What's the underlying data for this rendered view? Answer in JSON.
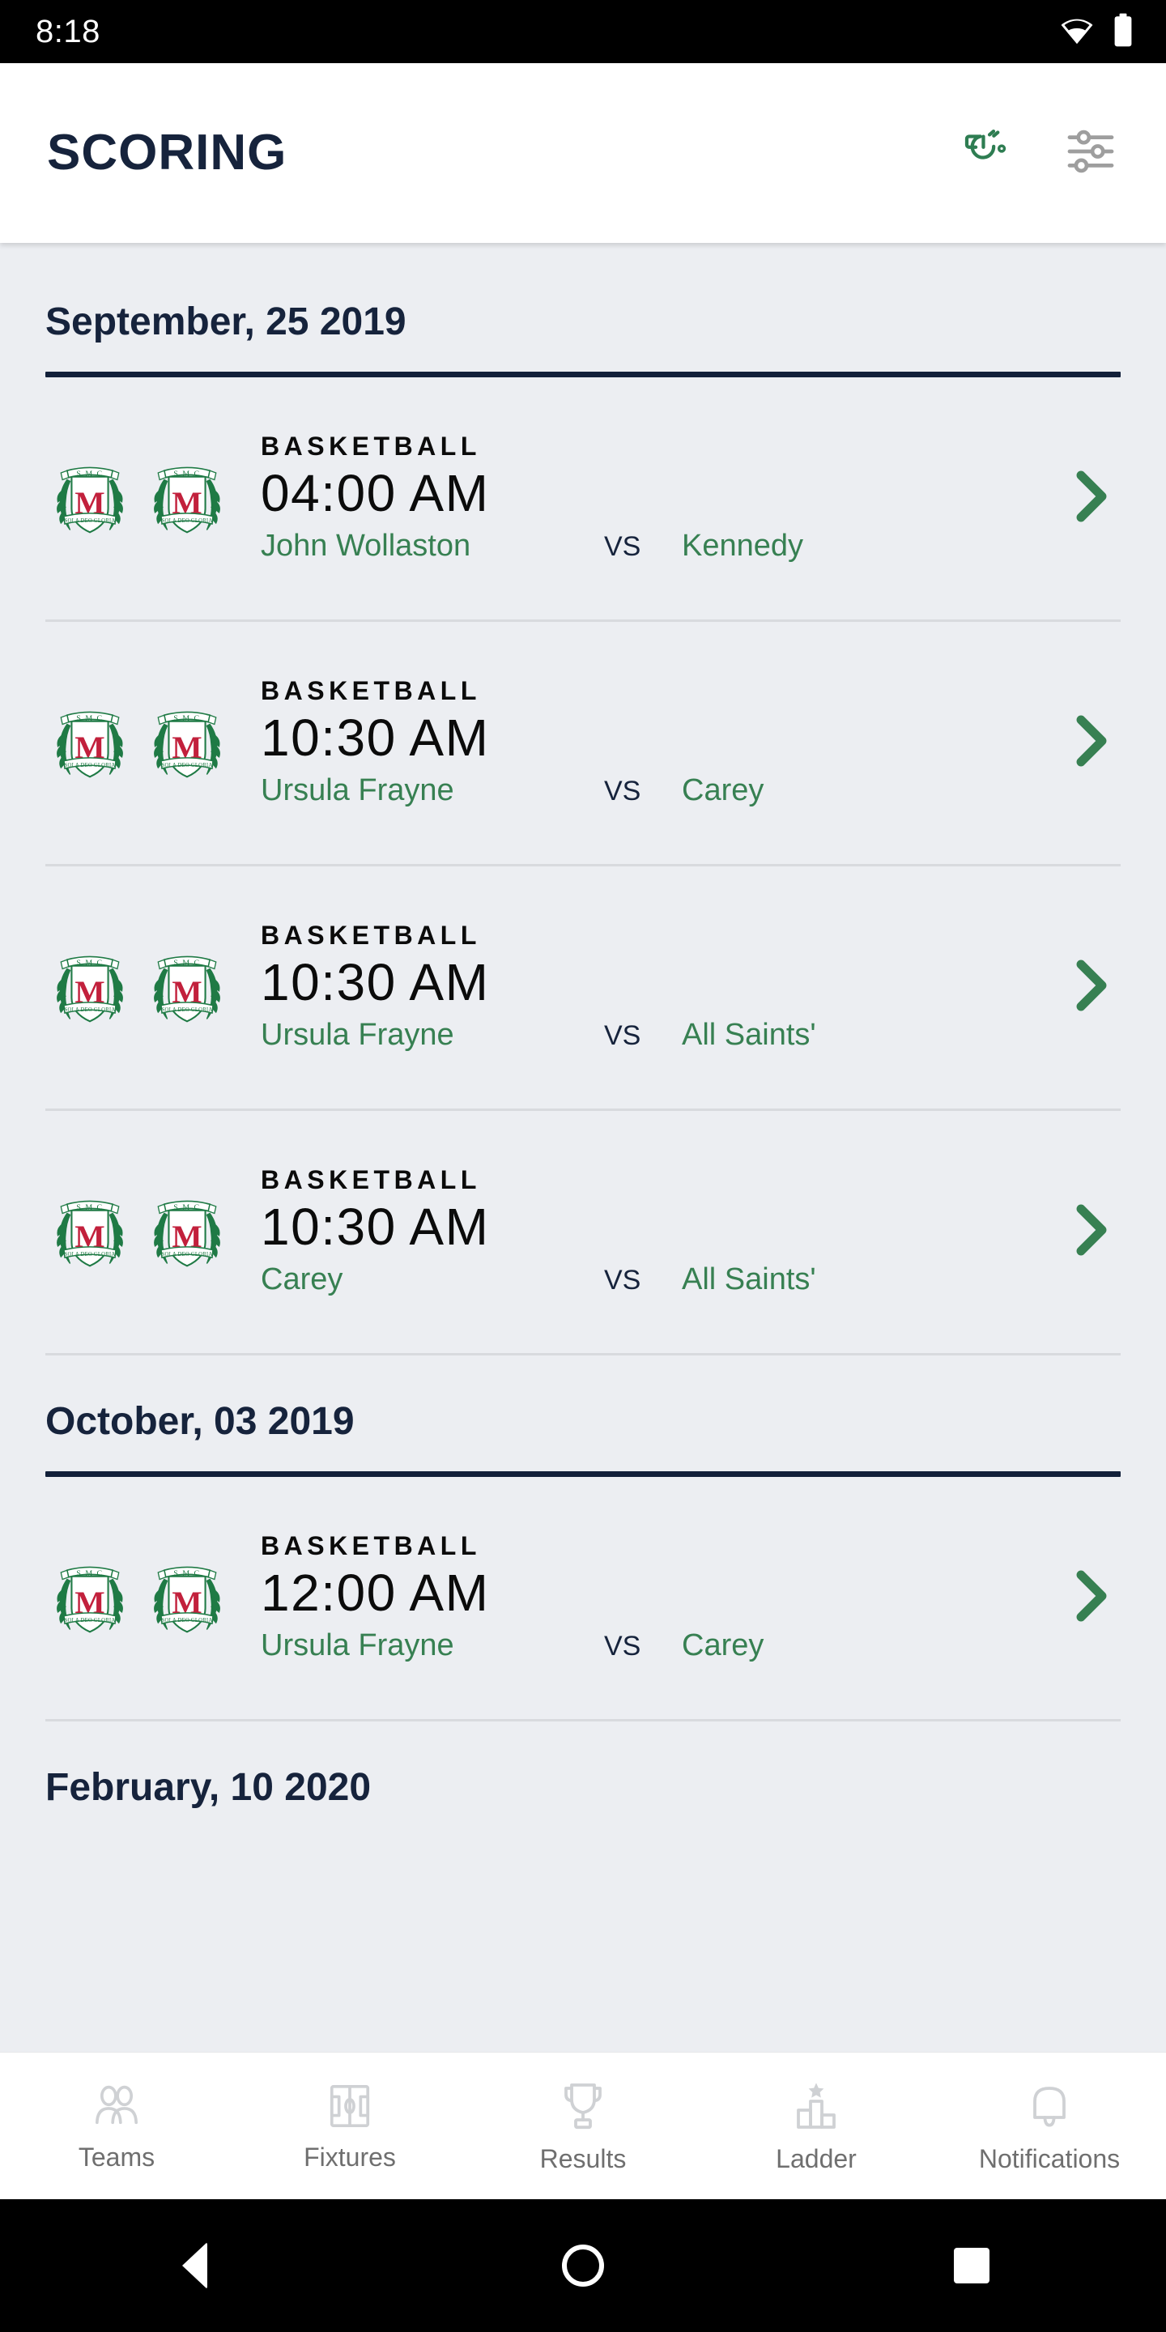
{
  "status_bar": {
    "time": "8:18",
    "wifi_icon": "wifi-icon",
    "battery_icon": "battery-full-icon"
  },
  "app_bar": {
    "title": "SCORING",
    "whistle_icon": "whistle-icon",
    "filter_icon": "filter-sliders-icon",
    "whistle_color": "#2e7d52",
    "filter_color": "#9e9e9e"
  },
  "theme": {
    "background": "#eceef2",
    "navy": "#16233c",
    "green": "#378052",
    "divider": "#d8dade",
    "surface": "#ffffff"
  },
  "sections": [
    {
      "date": "September, 25 2019",
      "matches": [
        {
          "sport": "BASKETBALL",
          "time": "04:00 AM",
          "home": "John Wollaston",
          "vs": "VS",
          "away": "Kennedy",
          "home_crest": "smc-crest-icon",
          "away_crest": "smc-crest-icon",
          "chevron": "chevron-right-icon"
        },
        {
          "sport": "BASKETBALL",
          "time": "10:30 AM",
          "home": "Ursula Frayne",
          "vs": "VS",
          "away": "Carey",
          "home_crest": "smc-crest-icon",
          "away_crest": "smc-crest-icon",
          "chevron": "chevron-right-icon"
        },
        {
          "sport": "BASKETBALL",
          "time": "10:30 AM",
          "home": "Ursula Frayne",
          "vs": "VS",
          "away": "All Saints'",
          "home_crest": "smc-crest-icon",
          "away_crest": "smc-crest-icon",
          "chevron": "chevron-right-icon"
        },
        {
          "sport": "BASKETBALL",
          "time": "10:30 AM",
          "home": "Carey",
          "vs": "VS",
          "away": "All Saints'",
          "home_crest": "smc-crest-icon",
          "away_crest": "smc-crest-icon",
          "chevron": "chevron-right-icon"
        }
      ]
    },
    {
      "date": "October, 03 2019",
      "matches": [
        {
          "sport": "BASKETBALL",
          "time": "12:00 AM",
          "home": "Ursula Frayne",
          "vs": "VS",
          "away": "Carey",
          "home_crest": "smc-crest-icon",
          "away_crest": "smc-crest-icon",
          "chevron": "chevron-right-icon"
        }
      ]
    },
    {
      "date": "February, 10 2020",
      "matches": []
    }
  ],
  "crest": {
    "banner_text": "S M C",
    "ribbon_text": "SOLA DEO GLORIA",
    "monogram": "M",
    "green": "#1f7a45",
    "red": "#c2203c"
  },
  "bottom_nav": {
    "items": [
      {
        "label": "Teams",
        "icon": "teams-people-icon"
      },
      {
        "label": "Fixtures",
        "icon": "fixtures-field-icon"
      },
      {
        "label": "Results",
        "icon": "results-trophy-icon"
      },
      {
        "label": "Ladder",
        "icon": "ladder-podium-icon"
      },
      {
        "label": "Notifications",
        "icon": "notifications-bell-icon"
      }
    ]
  },
  "android_nav": {
    "back": "back-triangle-icon",
    "home": "home-circle-icon",
    "recent": "recent-square-icon"
  }
}
